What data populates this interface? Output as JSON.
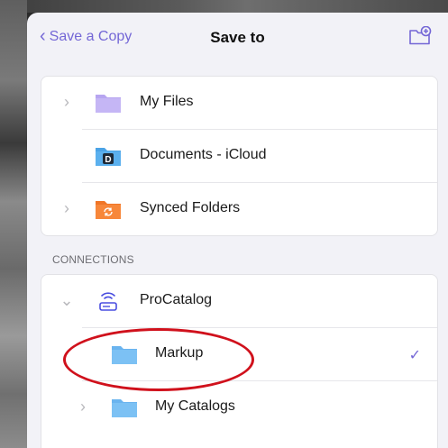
{
  "navbar": {
    "back_label": "Save a Copy",
    "title": "Save to",
    "new_folder_icon": "folder-plus-icon"
  },
  "locations": [
    {
      "label": "My Files",
      "icon": "folder-icon",
      "icon_color": "#b7a5f0",
      "has_disclosure": true
    },
    {
      "label": "Documents - iCloud",
      "icon": "documents-app-icon",
      "icon_color": "#5bb0ee",
      "has_disclosure": false
    },
    {
      "label": "Synced Folders",
      "icon": "synced-folder-icon",
      "icon_color": "#f7873a",
      "has_disclosure": true
    }
  ],
  "connections": {
    "header": "CONNECTIONS",
    "items": [
      {
        "label": "ProCatalog",
        "icon": "router-icon",
        "expanded": true
      },
      {
        "label": "Markup",
        "icon": "folder-icon",
        "selected": true,
        "icon_color": "#7cc1f4"
      },
      {
        "label": "My Catalogs",
        "icon": "folder-icon",
        "icon_color": "#7cc1f4",
        "has_disclosure": true
      }
    ]
  },
  "colors": {
    "accent": "#7467d6",
    "annotation": "#d0111c",
    "sheet_background": "#f2f2f7"
  }
}
